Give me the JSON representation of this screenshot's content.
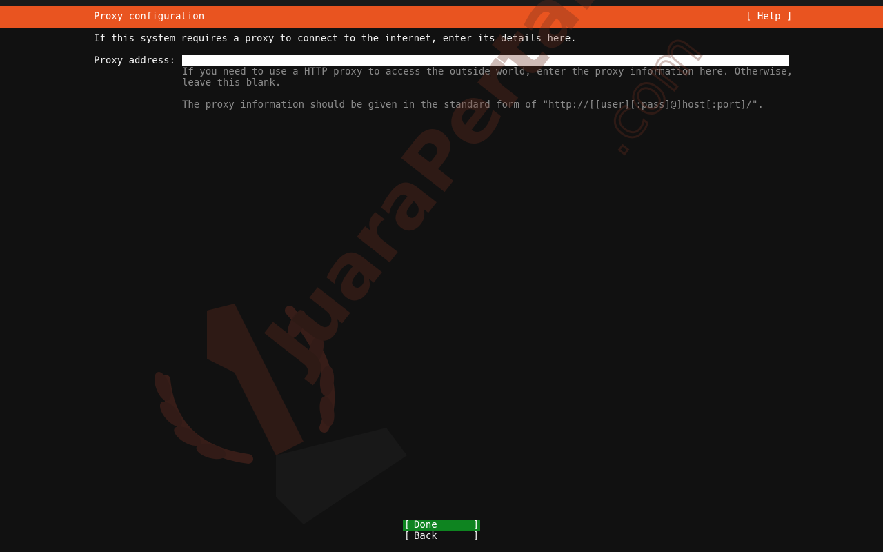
{
  "header": {
    "title": "Proxy configuration",
    "help_label": "[ Help ]"
  },
  "intro_text": "If this system requires a proxy to connect to the internet, enter its details here.",
  "proxy_field": {
    "label": "Proxy address:",
    "value": "",
    "help_line_1": "If you need to use a HTTP proxy to access the outside world, enter the proxy information here. Otherwise,",
    "help_line_2": "leave this blank.",
    "help_line_3": "The proxy information should be given in the standard form of \"http://[[user][:pass]@]host[:port]/\"."
  },
  "buttons": {
    "bracket_left": "[",
    "bracket_right": "]",
    "done_label": "Done",
    "back_label": "Back"
  },
  "watermark": {
    "text": "JuaraPertama",
    "suffix": ".com",
    "digit": "1"
  },
  "colors": {
    "header_bg": "#e95420",
    "done_bg": "#0e8420",
    "background": "#111111"
  }
}
